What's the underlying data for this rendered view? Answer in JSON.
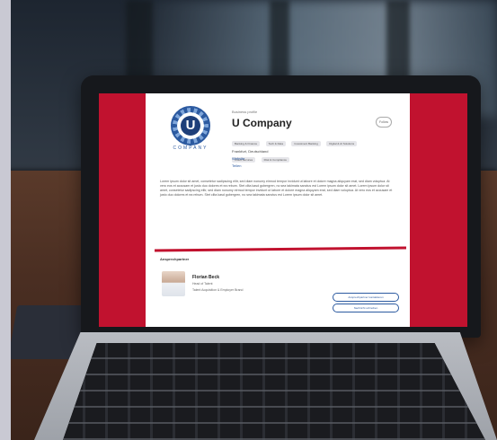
{
  "screen_page": {
    "logo_letter": "U",
    "logo_word": "COMPANY",
    "eyebrow": "Business profile",
    "company_name": "U Company",
    "follow_label": "Follow",
    "tags": [
      "Banking & Finance",
      "Tech & Data",
      "Investment Banking",
      "Digital & AI Solutions",
      "Cloud Services",
      "Risk & Compliance"
    ],
    "location": "Frankfurt, Deutschland",
    "website_link": "Website",
    "share_link": "Teilen",
    "description": "Lorem ipsum dolor sit amet, consetetur sadipscing elitr, sed diam nonumy eirmod tempor invidunt ut labore et dolore magna aliquyam erat, sed diam voluptua. At vero eos et accusam et justo duo dolores et ea rebum. Stet clita kasd gubergren, no sea takimata sanctus est Lorem ipsum dolor sit amet. Lorem ipsum dolor sit amet, consetetur sadipscing elitr, sed diam nonumy eirmod tempor invidunt ut labore et dolore magna aliquyam erat, sed diam voluptua. At vero eos et accusam et justo duo dolores et ea rebum. Stet clita kasd gubergren, no sea takimata sanctus est Lorem ipsum dolor sit amet.",
    "section_heading": "Ansprechpartner",
    "person_name": "Florian Beck",
    "person_role": "Head of Talent",
    "person_sub": "Talent Acquisition & Employer Brand",
    "contact_button": "Ansprechpartner kontaktieren",
    "message_button": "Nachricht schreiben"
  },
  "colors": {
    "accent_red": "#c1122f",
    "brand_blue": "#2c5aa0"
  }
}
